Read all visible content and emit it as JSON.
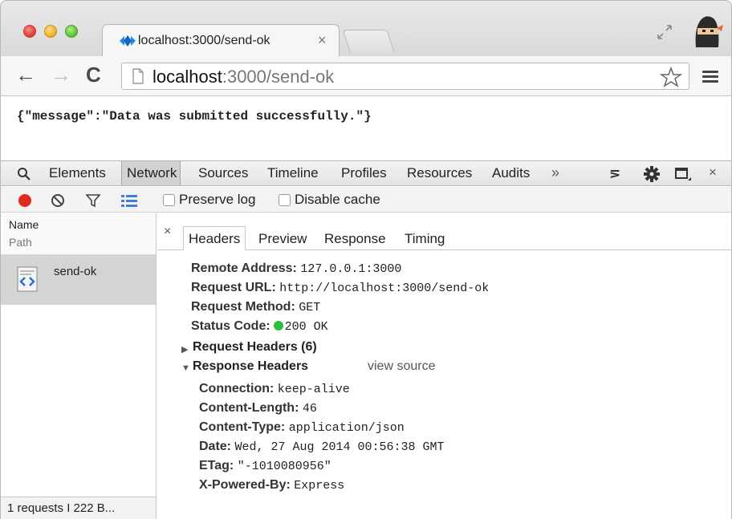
{
  "browser": {
    "tab_title": "localhost:3000/send-ok",
    "tab_close": "×",
    "url_host": "localhost",
    "url_rest": ":3000/send-ok",
    "nav_back": "←",
    "nav_forward": "→",
    "nav_reload": "C"
  },
  "page": {
    "json_text": "{\"message\":\"Data was submitted successfully.\"}"
  },
  "devtools": {
    "tabs": [
      "Elements",
      "Network",
      "Sources",
      "Timeline",
      "Profiles",
      "Resources",
      "Audits"
    ],
    "active_tab": "Network",
    "more": "»",
    "console_icon": "⋝",
    "close": "×",
    "preserve_log": "Preserve log",
    "disable_cache": "Disable cache",
    "columns": {
      "name": "Name",
      "path": "Path"
    },
    "requests": [
      {
        "name": "send-ok"
      }
    ],
    "summary": "1 requests I 222 B...",
    "detail_close": "×",
    "detail_tabs": [
      "Headers",
      "Preview",
      "Response",
      "Timing"
    ],
    "active_detail_tab": "Headers",
    "general": {
      "remote_address_key": "Remote Address:",
      "remote_address": "127.0.0.1:3000",
      "request_url_key": "Request URL:",
      "request_url": "http://localhost:3000/send-ok",
      "request_method_key": "Request Method:",
      "request_method": "GET",
      "status_code_key": "Status Code:",
      "status_code": "200 OK",
      "status_color": "#2ebd3c"
    },
    "request_headers_label": "Request Headers (6)",
    "response_headers_label": "Response Headers",
    "view_source": "view source",
    "response_headers": [
      {
        "key": "Connection:",
        "value": "keep-alive"
      },
      {
        "key": "Content-Length:",
        "value": "46"
      },
      {
        "key": "Content-Type:",
        "value": "application/json"
      },
      {
        "key": "Date:",
        "value": "Wed, 27 Aug 2014 00:56:38 GMT"
      },
      {
        "key": "ETag:",
        "value": "\"-1010080956\""
      },
      {
        "key": "X-Powered-By:",
        "value": "Express"
      }
    ]
  },
  "colors": {
    "record": "#e02a1f",
    "active_tab_bg": "#d2d2d2",
    "selected_row_bg": "#d4d4d4"
  }
}
